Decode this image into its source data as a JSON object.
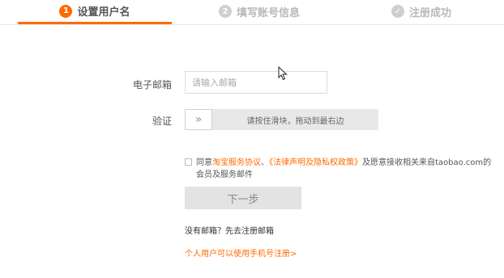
{
  "steps": [
    {
      "number": "1",
      "label": "设置用户名"
    },
    {
      "number": "2",
      "label": "填写账号信息"
    },
    {
      "number": "✓",
      "label": "注册成功"
    }
  ],
  "form": {
    "email_label": "电子邮箱",
    "email_placeholder": "请输入邮箱",
    "email_value": "",
    "verify_label": "验证",
    "slider_handle_glyph": "»",
    "slider_text": "请按住滑块，拖动到最右边"
  },
  "agreement": {
    "prefix": "同意",
    "service_agreement": "淘宝服务协议",
    "separator": "、",
    "privacy_policy": "《法律声明及隐私权政策》",
    "suffix": "及愿意接收相关来自taobao.com的会员及服务邮件",
    "checked": false
  },
  "buttons": {
    "next_label": "下一步"
  },
  "links": {
    "no_email": "没有邮箱？先去注册邮箱",
    "mobile_register": "个人用户可以使用手机号注册>"
  },
  "colors": {
    "accent": "#ff6a00",
    "disabled_button": "#e3e3e3",
    "slider_track": "#e8e8e8"
  },
  "icons": {
    "step_done": "check-circle-icon",
    "slider_handle": "double-chevron-right-icon",
    "cursor": "mouse-pointer-icon"
  }
}
